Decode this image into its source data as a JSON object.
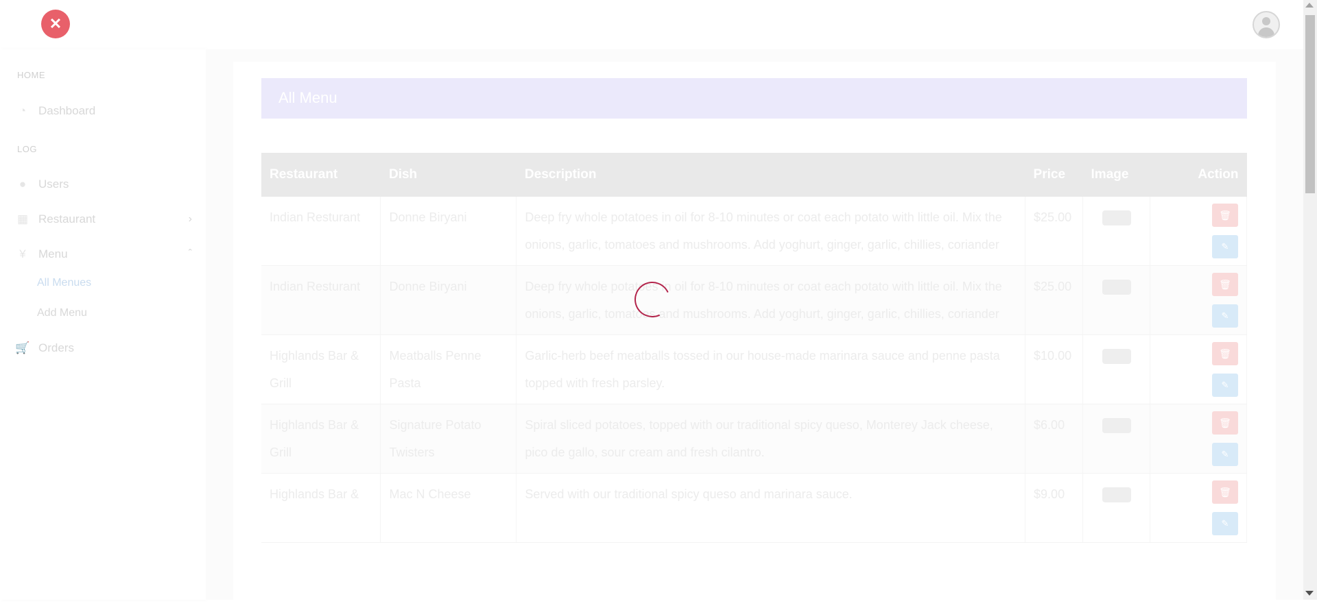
{
  "sidebar": {
    "home_label": "HOME",
    "log_label": "LOG",
    "items": {
      "dashboard": "Dashboard",
      "users": "Users",
      "restaurant": "Restaurant",
      "menu": "Menu",
      "orders": "Orders"
    },
    "menu_sub": {
      "all_menues": "All Menues",
      "add_menu": "Add Menu"
    }
  },
  "page": {
    "banner_title": "All Menu"
  },
  "table": {
    "headers": [
      "Restaurant",
      "Dish",
      "Description",
      "Price",
      "Image",
      "Action"
    ],
    "rows": [
      {
        "restaurant": "Indian Resturant",
        "dish": "Donne Biryani",
        "description": "Deep fry whole potatoes in oil for 8-10 minutes or coat each potato with little oil. Mix the onions, garlic, tomatoes and mushrooms. Add yoghurt, ginger, garlic, chillies, coriander",
        "price": "$25.00"
      },
      {
        "restaurant": "Indian Resturant",
        "dish": "Donne Biryani",
        "description": "Deep fry whole potatoes in oil for 8-10 minutes or coat each potato with little oil. Mix the onions, garlic, tomatoes and mushrooms. Add yoghurt, ginger, garlic, chillies, coriander",
        "price": "$25.00"
      },
      {
        "restaurant": "Highlands Bar & Grill",
        "dish": "Meatballs Penne Pasta",
        "description": "Garlic-herb beef meatballs tossed in our house-made marinara sauce and penne pasta topped with fresh parsley.",
        "price": "$10.00"
      },
      {
        "restaurant": "Highlands Bar & Grill",
        "dish": "Signature Potato Twisters",
        "description": "Spiral sliced potatoes, topped with our traditional spicy queso, Monterey Jack cheese, pico de gallo, sour cream and fresh cilantro.",
        "price": "$6.00"
      },
      {
        "restaurant": "Highlands Bar &",
        "dish": "Mac N Cheese",
        "description": "Served with our traditional spicy queso and marinara sauce.",
        "price": "$9.00"
      }
    ]
  },
  "colors": {
    "spinner": "#b3244b",
    "banner": "#ebe9fb",
    "delete_button": "#f9dada",
    "edit_button": "#d8eaf8"
  }
}
